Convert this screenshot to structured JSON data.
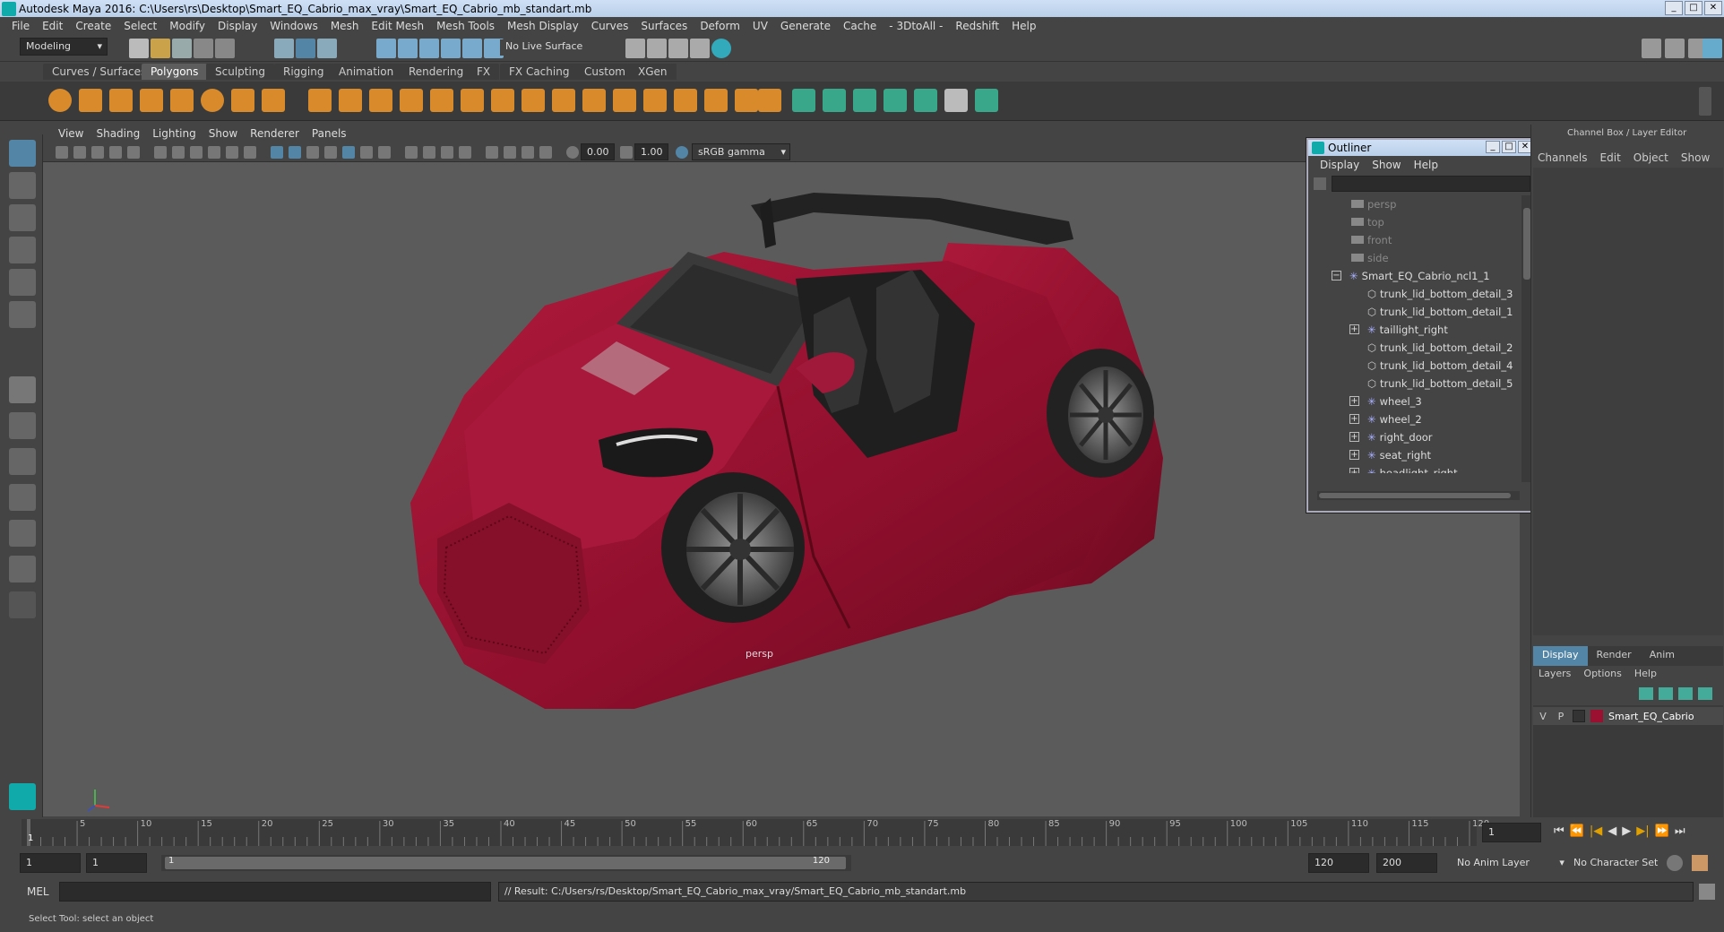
{
  "window": {
    "title": "Autodesk Maya 2016: C:\\Users\\rs\\Desktop\\Smart_EQ_Cabrio_max_vray\\Smart_EQ_Cabrio_mb_standart.mb"
  },
  "menubar": [
    "File",
    "Edit",
    "Create",
    "Select",
    "Modify",
    "Display",
    "Windows",
    "Mesh",
    "Edit Mesh",
    "Mesh Tools",
    "Mesh Display",
    "Curves",
    "Surfaces",
    "Deform",
    "UV",
    "Generate",
    "Cache",
    "- 3DtoAll -",
    "Redshift",
    "Help"
  ],
  "status": {
    "mode": "Modeling",
    "live_surface": "No Live Surface"
  },
  "shelf_tabs": [
    "Curves / Surfaces",
    "Polygons",
    "Sculpting",
    "Rigging",
    "Animation",
    "Rendering",
    "FX",
    "FX Caching",
    "Custom",
    "XGen"
  ],
  "shelf_active": "Polygons",
  "viewport": {
    "menu": [
      "View",
      "Shading",
      "Lighting",
      "Show",
      "Renderer",
      "Panels"
    ],
    "exposure": "0.00",
    "gamma": "1.00",
    "color_space": "sRGB gamma",
    "camera_label": "persp"
  },
  "outliner": {
    "title": "Outliner",
    "menu": [
      "Display",
      "Show",
      "Help"
    ],
    "items": [
      {
        "label": "persp",
        "kind": "camera"
      },
      {
        "label": "top",
        "kind": "camera"
      },
      {
        "label": "front",
        "kind": "camera"
      },
      {
        "label": "side",
        "kind": "camera"
      },
      {
        "label": "Smart_EQ_Cabrio_ncl1_1",
        "kind": "group-open"
      },
      {
        "label": "trunk_lid_bottom_detail_3",
        "kind": "mesh"
      },
      {
        "label": "trunk_lid_bottom_detail_1",
        "kind": "mesh"
      },
      {
        "label": "taillight_right",
        "kind": "group"
      },
      {
        "label": "trunk_lid_bottom_detail_2",
        "kind": "mesh"
      },
      {
        "label": "trunk_lid_bottom_detail_4",
        "kind": "mesh"
      },
      {
        "label": "trunk_lid_bottom_detail_5",
        "kind": "mesh"
      },
      {
        "label": "wheel_3",
        "kind": "group"
      },
      {
        "label": "wheel_2",
        "kind": "group"
      },
      {
        "label": "right_door",
        "kind": "group"
      },
      {
        "label": "seat_right",
        "kind": "group"
      },
      {
        "label": "headlight_right",
        "kind": "group"
      }
    ]
  },
  "channel_box": {
    "title": "Channel Box / Layer Editor",
    "menu": [
      "Channels",
      "Edit",
      "Object",
      "Show"
    ],
    "layer_tabs": [
      "Display",
      "Render",
      "Anim"
    ],
    "layer_menu": [
      "Layers",
      "Options",
      "Help"
    ],
    "layer": {
      "v": "V",
      "p": "P",
      "name": "Smart_EQ_Cabrio",
      "color": "#9b1030"
    }
  },
  "timeline": {
    "ticks": [
      "1",
      "5",
      "10",
      "15",
      "20",
      "25",
      "30",
      "35",
      "40",
      "45",
      "50",
      "55",
      "60",
      "65",
      "70",
      "75",
      "80",
      "85",
      "90",
      "95",
      "100",
      "105",
      "110",
      "115",
      "120"
    ],
    "current_frame": "1"
  },
  "range": {
    "start": "1",
    "inner_start": "1",
    "slider_start": "1",
    "slider_end": "120",
    "end": "120",
    "outer_end": "200",
    "anim_layer": "No Anim Layer",
    "character_set": "No Character Set"
  },
  "cmd": {
    "lang": "MEL",
    "result": "// Result: C:/Users/rs/Desktop/Smart_EQ_Cabrio_max_vray/Smart_EQ_Cabrio_mb_standart.mb"
  },
  "help_line": "Select Tool: select an object",
  "colors": {
    "car_body": "#9b1030",
    "accent": "#5285a6"
  }
}
